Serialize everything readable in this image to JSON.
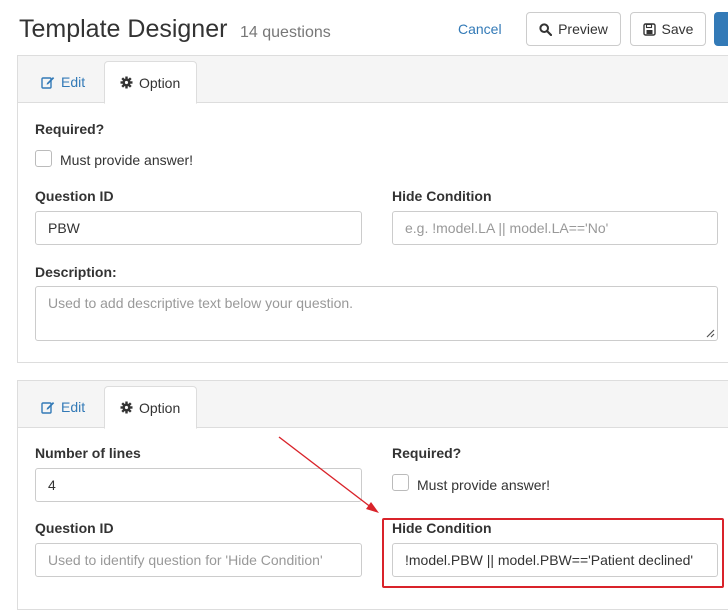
{
  "header": {
    "title": "Template Designer",
    "subtitle": "14 questions",
    "cancel_label": "Cancel",
    "preview_label": "Preview",
    "save_label": "Save"
  },
  "panel1": {
    "tabs": {
      "edit": "Edit",
      "option": "Option"
    },
    "required_label": "Required?",
    "must_provide": "Must provide answer!",
    "question_id_label": "Question ID",
    "question_id_value": "PBW",
    "hide_condition_label": "Hide Condition",
    "hide_condition_placeholder": "e.g. !model.LA || model.LA=='No'",
    "description_label": "Description:",
    "description_placeholder": "Used to add descriptive text below your question."
  },
  "panel2": {
    "tabs": {
      "edit": "Edit",
      "option": "Option"
    },
    "lines_label": "Number of lines",
    "lines_value": "4",
    "required_label": "Required?",
    "must_provide": "Must provide answer!",
    "question_id_label": "Question ID",
    "question_id_placeholder": "Used to identify question for 'Hide Condition'",
    "hide_condition_label": "Hide Condition",
    "hide_condition_value": "!model.PBW || model.PBW=='Patient declined'"
  },
  "colors": {
    "accent": "#337ab7",
    "annotation": "#d9232a"
  },
  "icons": [
    "edit-icon",
    "gear-icon",
    "search-icon",
    "save-icon"
  ]
}
